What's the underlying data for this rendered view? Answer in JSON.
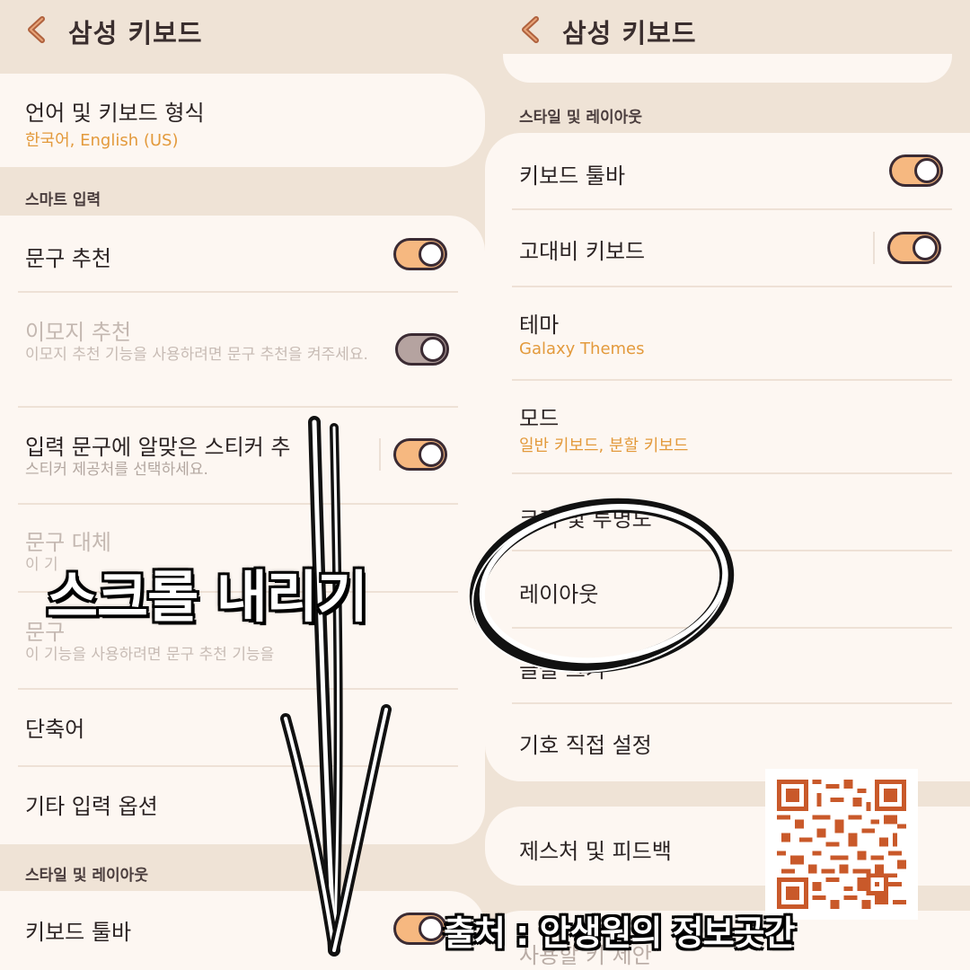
{
  "left_screen": {
    "header": {
      "title": "삼성 키보드"
    },
    "language": {
      "title": "언어 및 키보드 형식",
      "value": "한국어, English (US)"
    },
    "smart_input": {
      "section_title": "스마트 입력",
      "items": [
        {
          "title": "문구 추천",
          "toggle_on": true
        },
        {
          "title": "이모지 추천",
          "description": "이모지 추천 기능을 사용하려면 문구 추천을 켜주세요.",
          "toggle_on": true,
          "disabled": true
        },
        {
          "title": "입력 문구에 알맞은 스티커 추",
          "description": "스티커 제공처를 선택하세요.",
          "toggle_on": true
        },
        {
          "title": "문구 대체",
          "description": "이 기",
          "disabled": true
        },
        {
          "title": "문구",
          "description": "이 기능을 사용하려면 문구 추천 기능을",
          "disabled": true
        },
        {
          "title": "단축어"
        },
        {
          "title": "기타 입력 옵션"
        }
      ]
    },
    "style_layout": {
      "section_title": "스타일 및 레이아웃",
      "items": [
        {
          "title": "키보드 툴바",
          "toggle_on": true
        }
      ]
    }
  },
  "right_screen": {
    "header": {
      "title": "삼성 키보드"
    },
    "style_layout": {
      "section_title": "스타일 및 레이아웃",
      "items": [
        {
          "title": "키보드 툴바",
          "toggle_on": true
        },
        {
          "title": "고대비 키보드",
          "toggle_on": true
        },
        {
          "title": "테마",
          "value": "Galaxy Themes"
        },
        {
          "title": "모드",
          "value": "일반 키보드, 분할 키보드"
        },
        {
          "title": "크기 및 투명도"
        },
        {
          "title": "레이아웃"
        },
        {
          "title": "글꼴 크기"
        },
        {
          "title": "기호 직접 설정"
        }
      ]
    },
    "gestures": {
      "title": "제스처 및 피드백"
    },
    "partial_row": {
      "title": "사용할 키 제안"
    }
  },
  "overlay": {
    "banner": "스크롤 내리기",
    "credit": "출처 : 안생원의 정보곳간"
  },
  "colors": {
    "background": "#efe3d6",
    "card": "#fdf7f2",
    "accent_orange": "#e39a3c",
    "toggle_fill": "#f6b880",
    "toggle_border": "#3b2b33",
    "back_arrow": "#b0623e"
  }
}
